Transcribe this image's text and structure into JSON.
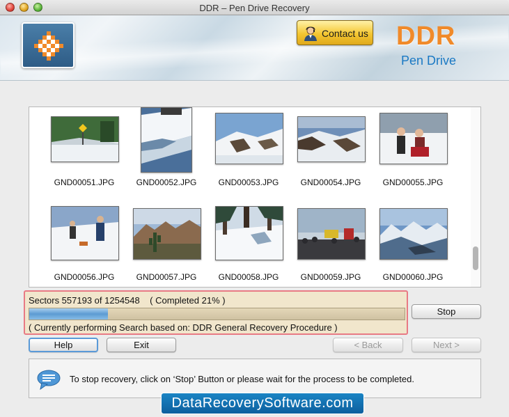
{
  "window": {
    "title": "DDR – Pen Drive Recovery"
  },
  "header": {
    "contact_label": "Contact us",
    "brand_name": "DDR",
    "brand_sub": "Pen Drive"
  },
  "gallery": {
    "files": [
      {
        "name": "GND00051.JPG",
        "scene": "snowy-road-sign"
      },
      {
        "name": "GND00052.JPG",
        "scene": "snow-slope"
      },
      {
        "name": "GND00053.JPG",
        "scene": "snowy-mountain"
      },
      {
        "name": "GND00054.JPG",
        "scene": "snowy-valley"
      },
      {
        "name": "GND00055.JPG",
        "scene": "people-in-snow"
      },
      {
        "name": "GND00056.JPG",
        "scene": "people-walking-snow"
      },
      {
        "name": "GND00057.JPG",
        "scene": "desert-cactus"
      },
      {
        "name": "GND00058.JPG",
        "scene": "snowy-forest"
      },
      {
        "name": "GND00059.JPG",
        "scene": "crowd-event"
      },
      {
        "name": "GND00060.JPG",
        "scene": "mountain-range"
      }
    ]
  },
  "progress": {
    "sectors_text": "Sectors 557193 of 1254548    ( Completed 21% )",
    "fraction": 0.21,
    "status_text": "( Currently performing Search based on: DDR General Recovery Procedure )",
    "stop_label": "Stop"
  },
  "nav": {
    "help_label": "Help",
    "exit_label": "Exit",
    "back_label": "< Back",
    "next_label": "Next >"
  },
  "info": {
    "message": "To stop recovery, click on ‘Stop’ Button or please wait for the process to be completed."
  },
  "watermark": {
    "text": "DataRecoverySoftware.com"
  },
  "colors": {
    "brand_orange": "#f08a2a",
    "brand_blue": "#1a79c4",
    "progress_border": "#e87a84",
    "watermark_bg": "#0d5f9e"
  }
}
